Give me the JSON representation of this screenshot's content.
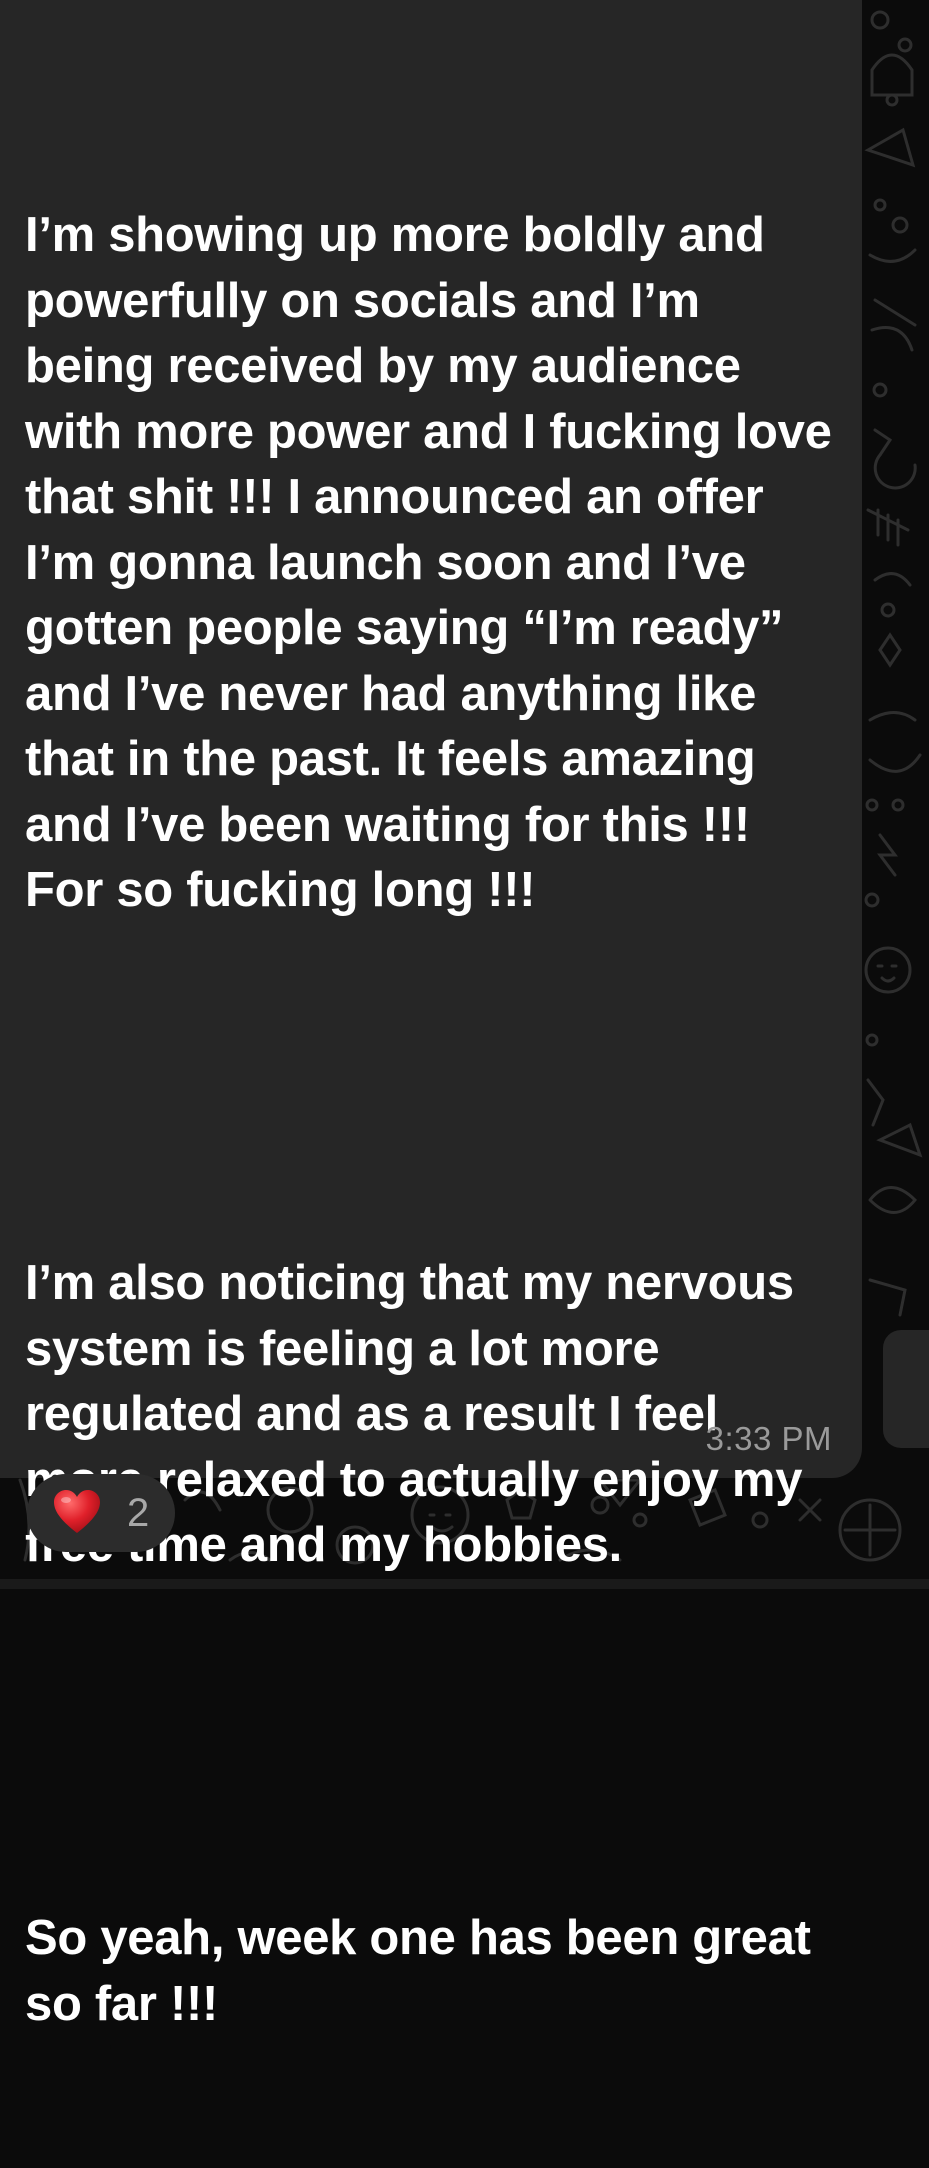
{
  "message": {
    "paragraphs": [
      "I’m showing up more boldly and powerfully on socials and I’m being received by my audience with more power and I fucking love that shit !!! I announced an offer I’m gonna launch soon and I’ve gotten people saying “I’m ready” and I’ve never had anything like that in the past. It feels amazing and I’ve been waiting for this !!! For so fucking long !!!",
      "I’m also noticing that my nervous system is feeling a lot more regulated and as a result I feel more relaxed to actually enjoy my free time and my hobbies.",
      "So yeah, week one has been great so far !!!"
    ],
    "time": "3:33 PM"
  },
  "reaction": {
    "emoji": "heart-icon",
    "count": "2"
  },
  "colors": {
    "bubble": "#262626",
    "background": "#0b0b0b",
    "text": "#ffffff",
    "timestamp": "#9a9a9a",
    "heart": "#e0202a"
  }
}
